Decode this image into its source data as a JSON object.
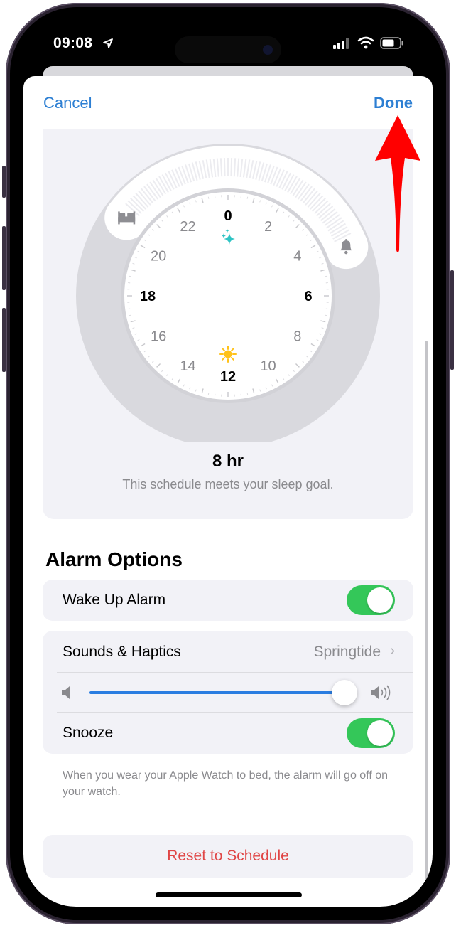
{
  "status_bar": {
    "time": "09:08",
    "location_icon": "location-arrow-icon",
    "signal_icon": "cellular-signal-icon",
    "wifi_icon": "wifi-icon",
    "battery_icon": "battery-icon"
  },
  "nav": {
    "cancel_label": "Cancel",
    "done_label": "Done"
  },
  "schedule": {
    "clock_hour_labels": [
      {
        "hour": 0,
        "label": "0",
        "emphasis": true
      },
      {
        "hour": 2,
        "label": "2",
        "emphasis": false
      },
      {
        "hour": 4,
        "label": "4",
        "emphasis": false
      },
      {
        "hour": 6,
        "label": "6",
        "emphasis": true
      },
      {
        "hour": 8,
        "label": "8",
        "emphasis": false
      },
      {
        "hour": 10,
        "label": "10",
        "emphasis": false
      },
      {
        "hour": 12,
        "label": "12",
        "emphasis": true
      },
      {
        "hour": 14,
        "label": "14",
        "emphasis": false
      },
      {
        "hour": 16,
        "label": "16",
        "emphasis": false
      },
      {
        "hour": 18,
        "label": "18",
        "emphasis": true
      },
      {
        "hour": 20,
        "label": "20",
        "emphasis": false
      },
      {
        "hour": 22,
        "label": "22",
        "emphasis": false
      }
    ],
    "bedtime_hour": 20.5,
    "wake_hour": 4.5,
    "bedtime_icon": "bed-icon",
    "wake_icon": "bell-icon",
    "night_icon": "sparkles-icon",
    "day_icon": "sun-icon",
    "duration": "8 hr",
    "goal_message": "This schedule meets your sleep goal."
  },
  "alarm_options": {
    "title": "Alarm Options",
    "wake_up_alarm": {
      "label": "Wake Up Alarm",
      "on": true
    },
    "sounds_haptics": {
      "label": "Sounds & Haptics",
      "value": "Springtide"
    },
    "volume": {
      "level": 0.93,
      "min_icon": "speaker-low-icon",
      "max_icon": "speaker-high-icon"
    },
    "snooze": {
      "label": "Snooze",
      "on": true
    },
    "footnote": "When you wear your Apple Watch to bed, the alarm will go off on your watch."
  },
  "reset_label": "Reset to Schedule",
  "colors": {
    "accent_blue": "#2d7fd3",
    "toggle_green": "#34c759",
    "destructive_red": "#e04646",
    "annotation_red": "#ff0000",
    "sparkle_teal": "#2ec4c4",
    "sun_yellow": "#ffc21a"
  }
}
